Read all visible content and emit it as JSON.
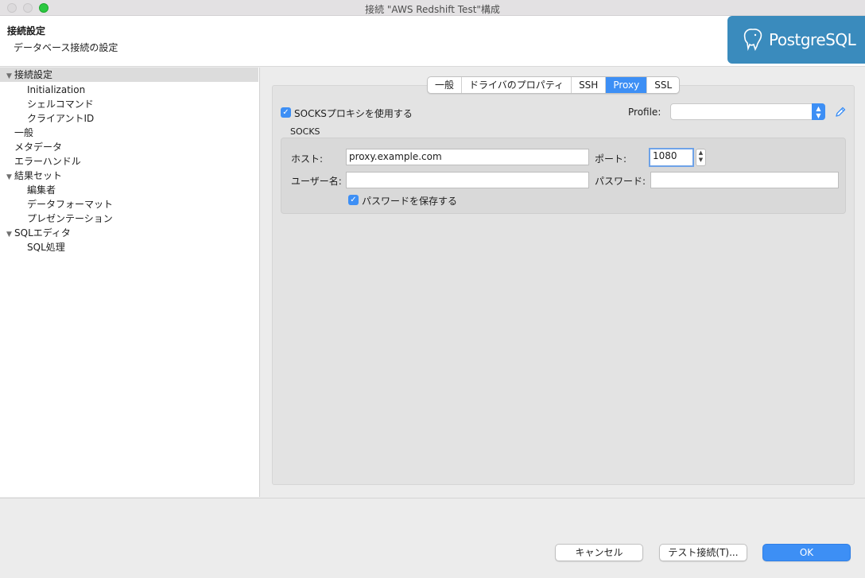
{
  "window": {
    "title": "接続 \"AWS Redshift Test\"構成"
  },
  "header": {
    "title": "接続設定",
    "description": "データベース接続の設定",
    "logo_text": "PostgreSQL"
  },
  "sidebar": {
    "items": [
      {
        "label": "接続設定",
        "level": 0,
        "expanded": true,
        "selected": true
      },
      {
        "label": "Initialization",
        "level": 1
      },
      {
        "label": "シェルコマンド",
        "level": 1
      },
      {
        "label": "クライアントID",
        "level": 1
      },
      {
        "label": "一般",
        "level": 0
      },
      {
        "label": "メタデータ",
        "level": 0
      },
      {
        "label": "エラーハンドル",
        "level": 0
      },
      {
        "label": "結果セット",
        "level": 0,
        "expanded": true
      },
      {
        "label": "編集者",
        "level": 1
      },
      {
        "label": "データフォーマット",
        "level": 1
      },
      {
        "label": "プレゼンテーション",
        "level": 1
      },
      {
        "label": "SQLエディタ",
        "level": 0,
        "expanded": true
      },
      {
        "label": "SQL処理",
        "level": 1
      }
    ]
  },
  "tabs": [
    {
      "label": "一般"
    },
    {
      "label": "ドライバのプロパティ"
    },
    {
      "label": "SSH"
    },
    {
      "label": "Proxy",
      "active": true
    },
    {
      "label": "SSL"
    }
  ],
  "proxy": {
    "use_socks_label": "SOCKSプロキシを使用する",
    "use_socks_checked": true,
    "profile_label": "Profile:",
    "profile_value": "",
    "group_title": "SOCKS",
    "host_label": "ホスト:",
    "host_value": "proxy.example.com",
    "port_label": "ポート:",
    "port_value": "1080",
    "username_label": "ユーザー名:",
    "username_value": "",
    "password_label": "パスワード:",
    "password_value": "",
    "save_password_label": "パスワードを保存する",
    "save_password_checked": true
  },
  "footer": {
    "cancel": "キャンセル",
    "test": "テスト接続(T)...",
    "ok": "OK"
  },
  "colors": {
    "accent": "#3d8ff5",
    "logo_bg": "#3a8bbd"
  },
  "icons": {
    "edit": "pencil-icon",
    "expand": "triangle-down-icon"
  }
}
